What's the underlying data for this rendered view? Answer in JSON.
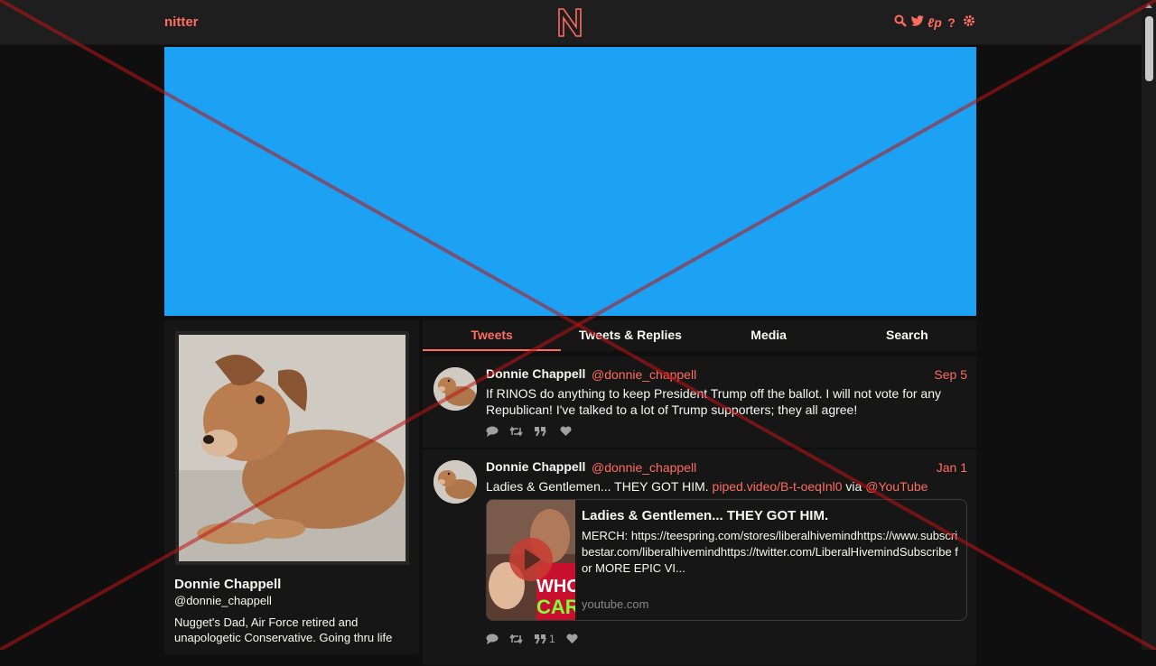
{
  "navbar": {
    "brand": "nitter",
    "icons": [
      "search-icon",
      "twitter-bird-icon",
      "rss-icon",
      "help-icon",
      "gear-icon"
    ]
  },
  "colors": {
    "accent": "#ff6c60",
    "banner": "#1da1f2",
    "background": "#0f0f0f",
    "panel": "#161616"
  },
  "profile": {
    "name": "Donnie Chappell",
    "handle": "@donnie_chappell",
    "bio": "Nugget's Dad, Air Force retired and unapologetic Conservative. Going thru life"
  },
  "tabs": [
    {
      "label": "Tweets",
      "active": true
    },
    {
      "label": "Tweets & Replies",
      "active": false
    },
    {
      "label": "Media",
      "active": false
    },
    {
      "label": "Search",
      "active": false
    }
  ],
  "tweets": [
    {
      "name": "Donnie Chappell",
      "handle": "@donnie_chappell",
      "date": "Sep 5",
      "text": "If RINOS do anything to keep President Trump off the ballot. I will not vote for any Republican!  I've talked to a lot of Trump supporters; they all agree!",
      "quote_count": ""
    },
    {
      "name": "Donnie Chappell",
      "handle": "@donnie_chappell",
      "date": "Jan 1",
      "text_prefix": "Ladies & Gentlemen... THEY GOT HIM. ",
      "link": "piped.video/B-t-oeqInl0",
      "via": " via ",
      "mention": "@YouTube",
      "quote_count": "1",
      "card": {
        "title": "Ladies & Gentlemen... THEY GOT HIM.",
        "description": "MERCH: https://teespring.com/stores/liberalhivemindhttps://www.subscribestar.com/liberalhivemindhttps://twitter.com/LiberalHivemindSubscribe for MORE EPIC VI...",
        "domain": "youtube.com",
        "thumb_text_1": "WHO",
        "thumb_text_2": "CAR"
      }
    }
  ]
}
